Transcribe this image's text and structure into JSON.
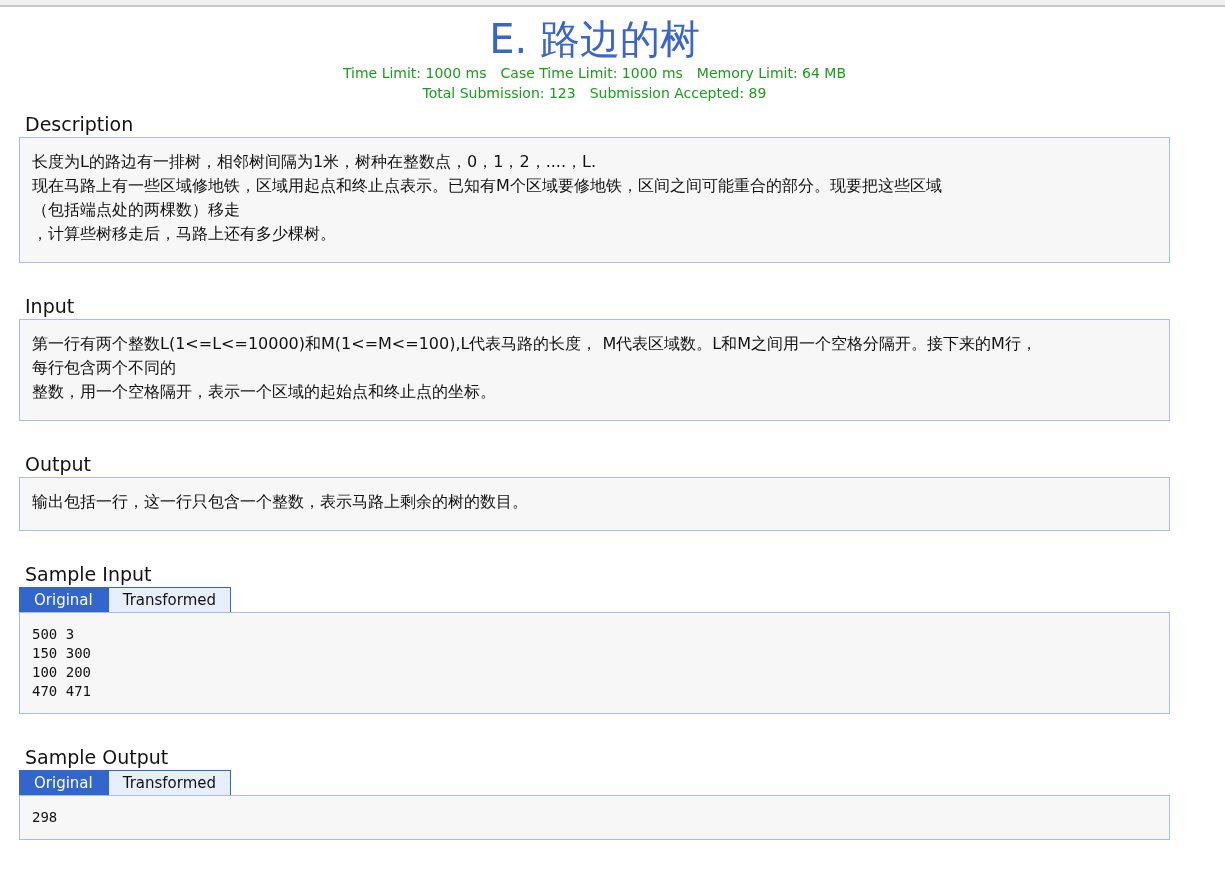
{
  "title": "E. 路边的树",
  "limits": [
    "Time Limit: 1000 ms",
    "Case Time Limit: 1000 ms",
    "Memory Limit: 64 MB"
  ],
  "stats": [
    "Total Submission: 123",
    "Submission Accepted: 89"
  ],
  "sections": [
    {
      "kind": "text",
      "heading": "Description",
      "lines": [
        "长度为L的路边有一排树，相邻树间隔为1米，树种在整数点，0，1，2，....，L.",
        "现在马路上有一些区域修地铁，区域用起点和终止点表示。已知有M个区域要修地铁，区间之间可能重合的部分。现要把这些区域",
        "（包括端点处的两棵数）移走",
        "，计算些树移走后，马路上还有多少棵树。"
      ]
    },
    {
      "kind": "text",
      "heading": "Input",
      "lines": [
        "第一行有两个整数L(1<=L<=10000)和M(1<=M<=100),L代表马路的长度， M代表区域数。L和M之间用一个空格分隔开。接下来的M行，",
        "每行包含两个不同的",
        "整数，用一个空格隔开，表示一个区域的起始点和终止点的坐标。"
      ]
    },
    {
      "kind": "text",
      "heading": "Output",
      "lines": [
        "输出包括一行，这一行只包含一个整数，表示马路上剩余的树的数目。"
      ]
    },
    {
      "kind": "sample",
      "heading": "Sample Input",
      "tabs": [
        {
          "label": "Original",
          "selected": true
        },
        {
          "label": "Transformed",
          "selected": false
        }
      ],
      "code": "500 3\n150 300\n100 200\n470 471"
    },
    {
      "kind": "sample",
      "heading": "Sample Output",
      "tabs": [
        {
          "label": "Original",
          "selected": true
        },
        {
          "label": "Transformed",
          "selected": false
        }
      ],
      "code": "298"
    }
  ]
}
